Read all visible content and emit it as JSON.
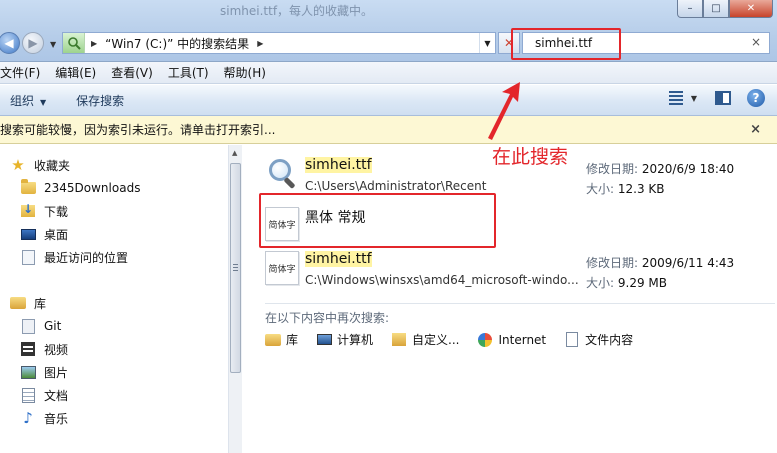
{
  "titlebar": {
    "ghost_title": "simhei.ttf，每人的收藏中。",
    "buttons": {
      "minimize": "–",
      "maximize": "□",
      "close": "✕"
    }
  },
  "address": {
    "path": "“Win7 (C:)” 中的搜索结果"
  },
  "search": {
    "value": "simhei.ttf",
    "clear": "×"
  },
  "menu": [
    "文件(F)",
    "编辑(E)",
    "查看(V)",
    "工具(T)",
    "帮助(H)"
  ],
  "toolbar": {
    "organize": "组织",
    "save_search": "保存搜索",
    "help": "?"
  },
  "infobar": {
    "text": "搜索可能较慢，因为索引未运行。请单击打开索引...",
    "close": "×"
  },
  "nav": {
    "favorites_label": "收藏夹",
    "favorites": [
      "2345Downloads",
      "下载",
      "桌面",
      "最近访问的位置"
    ],
    "libraries_label": "库",
    "libraries": [
      "Git",
      "视频",
      "图片",
      "文档",
      "音乐"
    ]
  },
  "results": [
    {
      "name": "simhei.ttf",
      "path": "C:\\Users\\Administrator\\Recent",
      "modified_label": "修改日期:",
      "modified": "2020/6/9 18:40",
      "size_label": "大小:",
      "size": "12.3 KB",
      "icon": "magnifier-icon"
    },
    {
      "name": "黑体 常规",
      "icon": "font-file-icon",
      "icon_text": "简体字"
    },
    {
      "name": "simhei.ttf",
      "path": "C:\\Windows\\winsxs\\amd64_microsoft-windo...",
      "modified_label": "修改日期:",
      "modified": "2009/6/11 4:43",
      "size_label": "大小:",
      "size": "9.29 MB",
      "icon": "font-file-icon",
      "icon_text": "简体字"
    }
  ],
  "search_again": {
    "title": "在以下内容中再次搜索:",
    "items": [
      "库",
      "计算机",
      "自定义...",
      "Internet",
      "文件内容"
    ]
  },
  "annotation": {
    "text": "在此搜索",
    "color": "#e3262b"
  }
}
